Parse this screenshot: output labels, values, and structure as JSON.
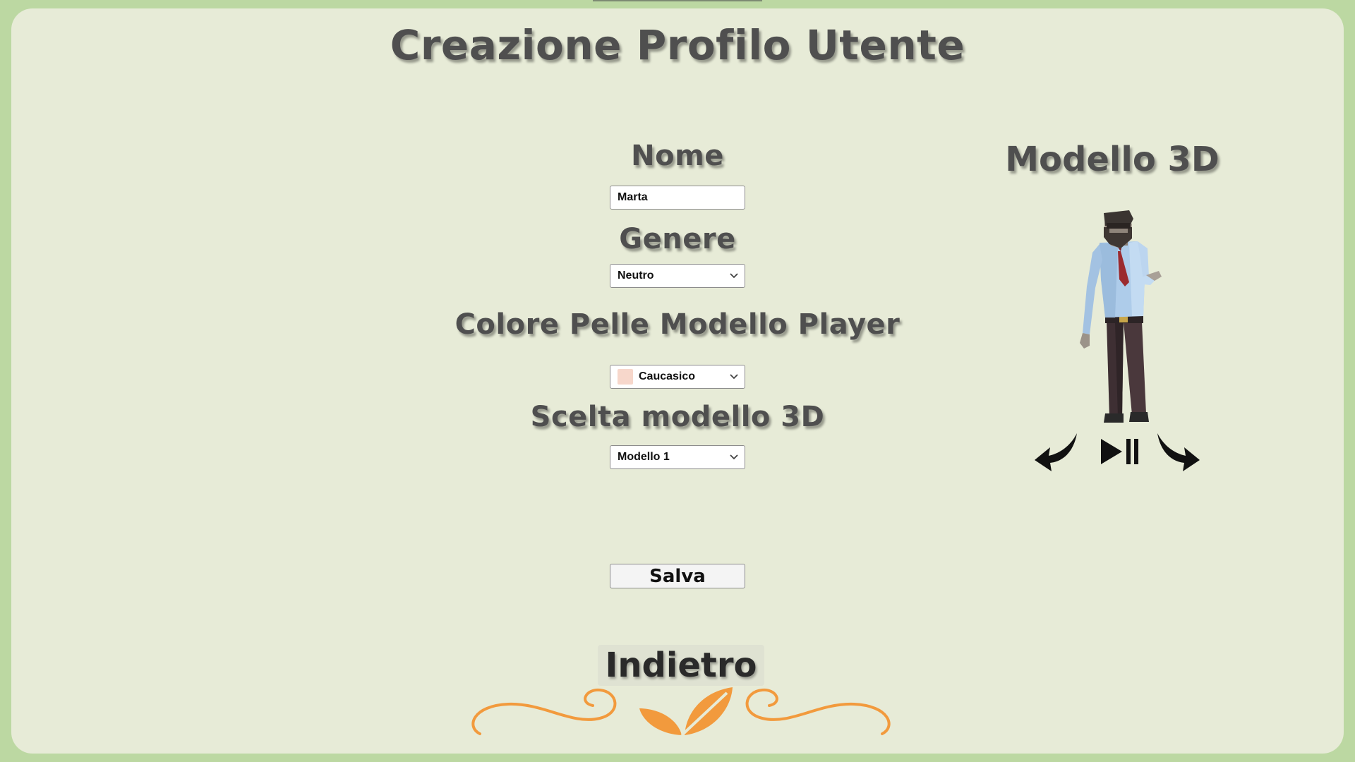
{
  "title": "Creazione Profilo Utente",
  "form": {
    "nome_label": "Nome",
    "nome_value": "Marta",
    "genere_label": "Genere",
    "genere_value": "Neutro",
    "pelle_label": "Colore Pelle Modello Player",
    "pelle_value": "Caucasico",
    "pelle_swatch_color": "#f7d7cb",
    "modello_label": "Scelta modello 3D",
    "modello_value": "Modello 1",
    "save_label": "Salva"
  },
  "preview": {
    "title": "Modello 3D",
    "controls": [
      "rotate-left-icon",
      "play-pause-icon",
      "rotate-right-icon"
    ]
  },
  "back_label": "Indietro",
  "colors": {
    "background": "#e7ebd7",
    "border": "#bcd8a2",
    "heading": "#4f4f4f",
    "ornament": "#f29a3d"
  }
}
